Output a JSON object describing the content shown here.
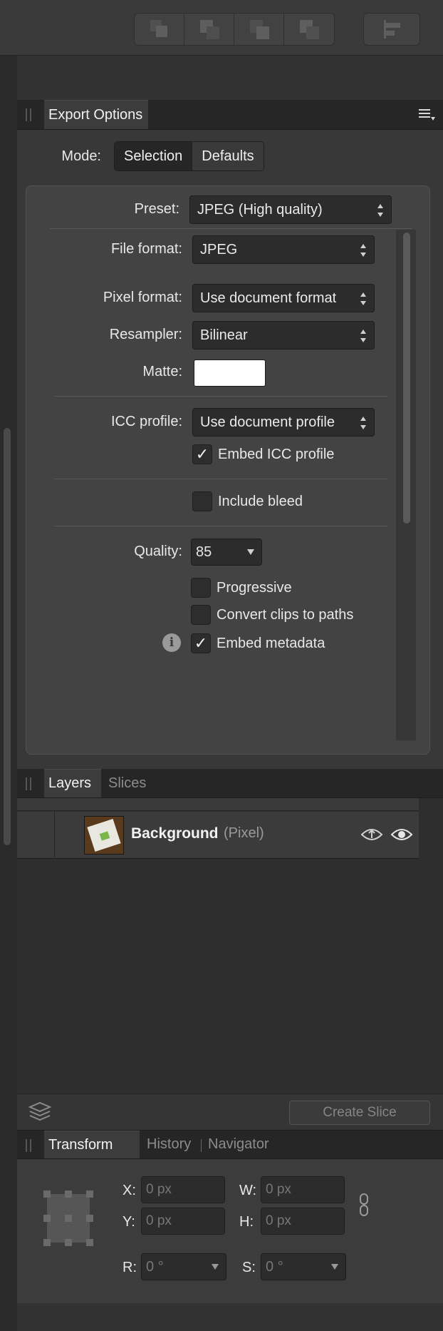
{
  "toolbar": {
    "icons": [
      "arrange-back-icon",
      "arrange-backward-icon",
      "arrange-forward-icon",
      "arrange-front-icon",
      "align-icon"
    ]
  },
  "export_panel": {
    "tab_label": "Export Options",
    "menu_icon": "hamburger-menu-icon",
    "mode_label": "Mode:",
    "mode_options": [
      "Selection",
      "Defaults"
    ],
    "mode_selected": "Selection",
    "preset_label": "Preset:",
    "preset_value": "JPEG (High quality)",
    "file_format_label": "File format:",
    "file_format_value": "JPEG",
    "pixel_format_label": "Pixel format:",
    "pixel_format_value": "Use document format",
    "resampler_label": "Resampler:",
    "resampler_value": "Bilinear",
    "matte_label": "Matte:",
    "matte_color": "#ffffff",
    "icc_label": "ICC profile:",
    "icc_value": "Use document profile",
    "embed_icc_label": "Embed ICC profile",
    "embed_icc_checked": "✓",
    "include_bleed_label": "Include bleed",
    "quality_label": "Quality:",
    "quality_value": "85",
    "progressive_label": "Progressive",
    "convert_clips_label": "Convert clips to paths",
    "embed_metadata_label": "Embed metadata",
    "embed_metadata_checked": "✓",
    "info_glyph": "i"
  },
  "layers_panel": {
    "tabs": [
      "Layers",
      "Slices"
    ],
    "layer": {
      "name": "Background",
      "type": "(Pixel)"
    },
    "create_slice_label": "Create Slice"
  },
  "transform_panel": {
    "tabs": [
      "Transform",
      "History",
      "Navigator"
    ],
    "x_label": "X:",
    "x_value": "0 px",
    "y_label": "Y:",
    "y_value": "0 px",
    "w_label": "W:",
    "w_value": "0 px",
    "h_label": "H:",
    "h_value": "0 px",
    "r_label": "R:",
    "r_value": "0 °",
    "s_label": "S:",
    "s_value": "0 °"
  },
  "colors": {
    "panel_bg": "#383838",
    "header_bg": "#262626",
    "text": "#e6e6e6"
  }
}
